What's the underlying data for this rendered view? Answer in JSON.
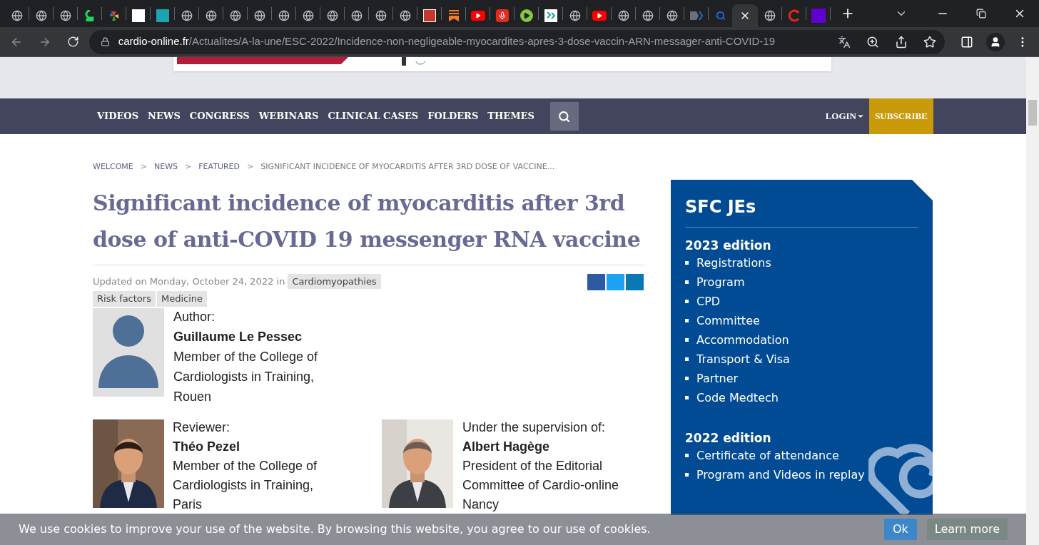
{
  "browser": {
    "tabs": [
      {
        "kind": "globe",
        "selected": false
      },
      {
        "kind": "globe",
        "selected": false
      },
      {
        "kind": "globe",
        "selected": false
      },
      {
        "kind": "green-logo",
        "selected": false
      },
      {
        "kind": "pinwheel",
        "selected": false
      },
      {
        "kind": "white-square",
        "selected": false
      },
      {
        "kind": "teal-logo",
        "selected": false
      },
      {
        "kind": "globe",
        "selected": false
      },
      {
        "kind": "globe",
        "selected": false
      },
      {
        "kind": "globe",
        "selected": false
      },
      {
        "kind": "globe",
        "selected": false
      },
      {
        "kind": "globe",
        "selected": false
      },
      {
        "kind": "globe",
        "selected": false
      },
      {
        "kind": "globe",
        "selected": false
      },
      {
        "kind": "globe",
        "selected": false
      },
      {
        "kind": "globe",
        "selected": false
      },
      {
        "kind": "globe",
        "selected": false
      },
      {
        "kind": "red-logo",
        "selected": false
      },
      {
        "kind": "bookmark",
        "selected": false
      },
      {
        "kind": "youtube",
        "selected": false
      },
      {
        "kind": "microphone",
        "selected": false
      },
      {
        "kind": "green-play",
        "selected": false
      },
      {
        "kind": "pattern",
        "selected": false
      },
      {
        "kind": "globe",
        "selected": false
      },
      {
        "kind": "youtube",
        "selected": false
      },
      {
        "kind": "globe",
        "selected": false
      },
      {
        "kind": "globe",
        "selected": false
      },
      {
        "kind": "globe",
        "selected": false
      },
      {
        "kind": "chevron",
        "selected": false
      },
      {
        "kind": "search",
        "selected": false
      },
      {
        "selected": true
      },
      {
        "kind": "globe",
        "selected": false
      },
      {
        "kind": "red-ring",
        "selected": false
      },
      {
        "kind": "purple-logo",
        "selected": false
      }
    ],
    "url_domain": "cardio-online.fr",
    "url_path": "/Actualites/A-la-une/ESC-2022/Incidence-non-negligeable-myocardites-apres-3-dose-vaccin-ARN-messager-anti-COVID-19"
  },
  "nav": {
    "items": [
      "VIDEOS",
      "NEWS",
      "CONGRESS",
      "WEBINARS",
      "CLINICAL CASES",
      "FOLDERS",
      "THEMES"
    ],
    "login": "LOGIN",
    "subscribe": "SUBSCRIBE"
  },
  "breadcrumb": {
    "separator": ">",
    "items": [
      {
        "label": "WELCOME",
        "kind": "link"
      },
      {
        "label": "NEWS",
        "kind": "link"
      },
      {
        "label": "FEATURED",
        "kind": "link"
      },
      {
        "label": "SIGNIFICANT INCIDENCE OF MYOCARDITIS AFTER 3RD DOSE OF VACCINE...",
        "kind": "current"
      }
    ]
  },
  "article": {
    "title": "Significant incidence of myocarditis after 3rd dose of anti-COVID 19 messenger RNA vaccine",
    "updated": "Updated on Monday, October 24, 2022 in",
    "tags_inline": [
      "Cardiomyopathies"
    ],
    "tags": [
      "Risk factors",
      "Medicine"
    ],
    "author": {
      "kind": "placeholder",
      "role": "Author:",
      "name": "Guillaume Le Pessec",
      "lines": [
        "Member of the College of",
        "Cardiologists in Training,",
        "Rouen"
      ]
    },
    "people": [
      {
        "role": "Reviewer:",
        "name": "Théo Pezel",
        "lines": [
          "Member of the College of",
          "Cardiologists in Training,",
          "Paris"
        ]
      },
      {
        "role": "Under the supervision of:",
        "name": "Albert Hagège",
        "lines": [
          "President of the Editorial",
          "Committee of Cardio-online",
          "Nancy"
        ]
      }
    ]
  },
  "sidebar": {
    "title": "SFC JEs",
    "sections": [
      {
        "heading": "2023 edition",
        "items": [
          "Registrations",
          "Program",
          "CPD",
          "Committee",
          "Accommodation",
          "Transport & Visa",
          "Partner",
          "Code Medtech"
        ]
      },
      {
        "heading": "2022 edition",
        "items": [
          "Certificate of attendance",
          "Program and Videos in replay"
        ]
      }
    ]
  },
  "cookie_bar": {
    "text": "We use cookies to improve your use of the website. By browsing this website, you agree to our use of cookies.",
    "ok": "Ok",
    "learn_more": "Learn more"
  }
}
